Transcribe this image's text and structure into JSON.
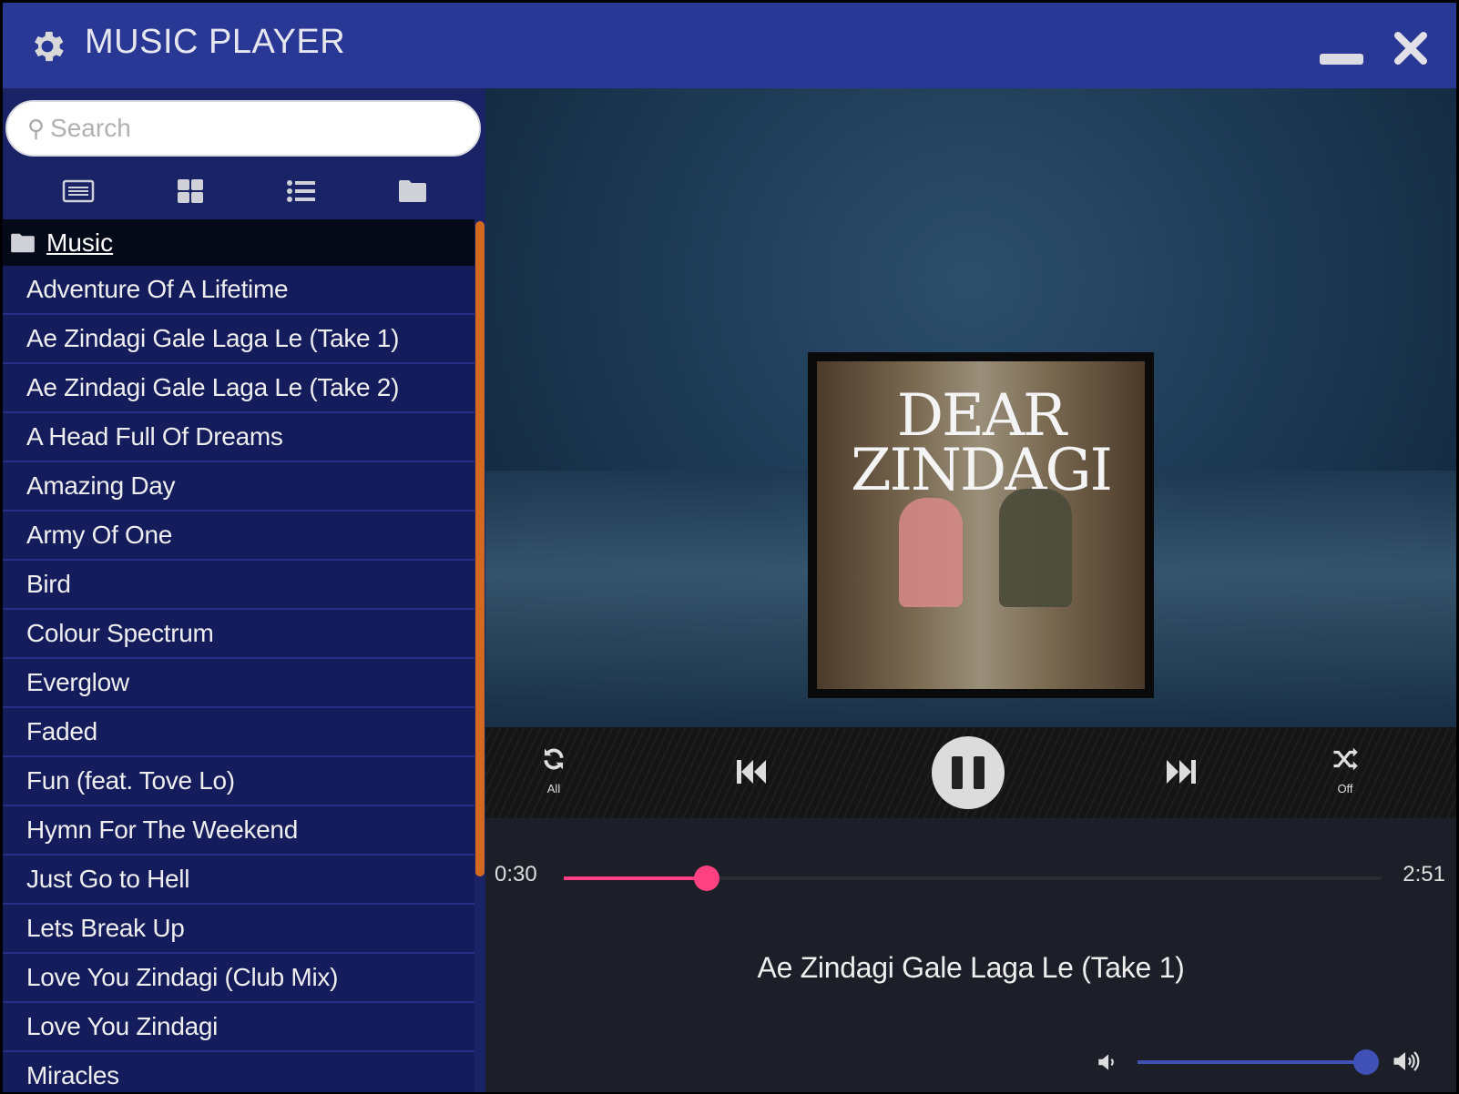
{
  "window": {
    "title": "MUSIC PLAYER"
  },
  "sidebar": {
    "search_placeholder": "Search",
    "folder": "Music",
    "items": [
      "Adventure Of A Lifetime",
      "Ae Zindagi Gale Laga Le (Take 1)",
      "Ae Zindagi Gale Laga Le (Take 2)",
      "A Head Full Of Dreams",
      "Amazing Day",
      "Army Of One",
      "Bird",
      "Colour Spectrum",
      "Everglow",
      "Faded",
      "Fun (feat. Tove Lo)",
      "Hymn For The Weekend",
      "Just Go to Hell",
      "Lets Break Up",
      "Love You Zindagi (Club Mix)",
      "Love You Zindagi",
      "Miracles"
    ]
  },
  "album_art": {
    "title_line1": "DEAR",
    "title_line2": "ZINDAGI"
  },
  "controls": {
    "repeat_label": "All",
    "shuffle_label": "Off"
  },
  "player": {
    "current_time": "0:30",
    "total_time": "2:51",
    "progress": 0.175,
    "song_title": "Ae Zindagi Gale Laga Le (Take 1)",
    "volume": 0.98
  },
  "colors": {
    "titlebar": "#293894",
    "sidebar": "#1a2366",
    "progress": "#ff4081",
    "volume": "#3f51b5",
    "scrollbar": "#d2691e"
  }
}
